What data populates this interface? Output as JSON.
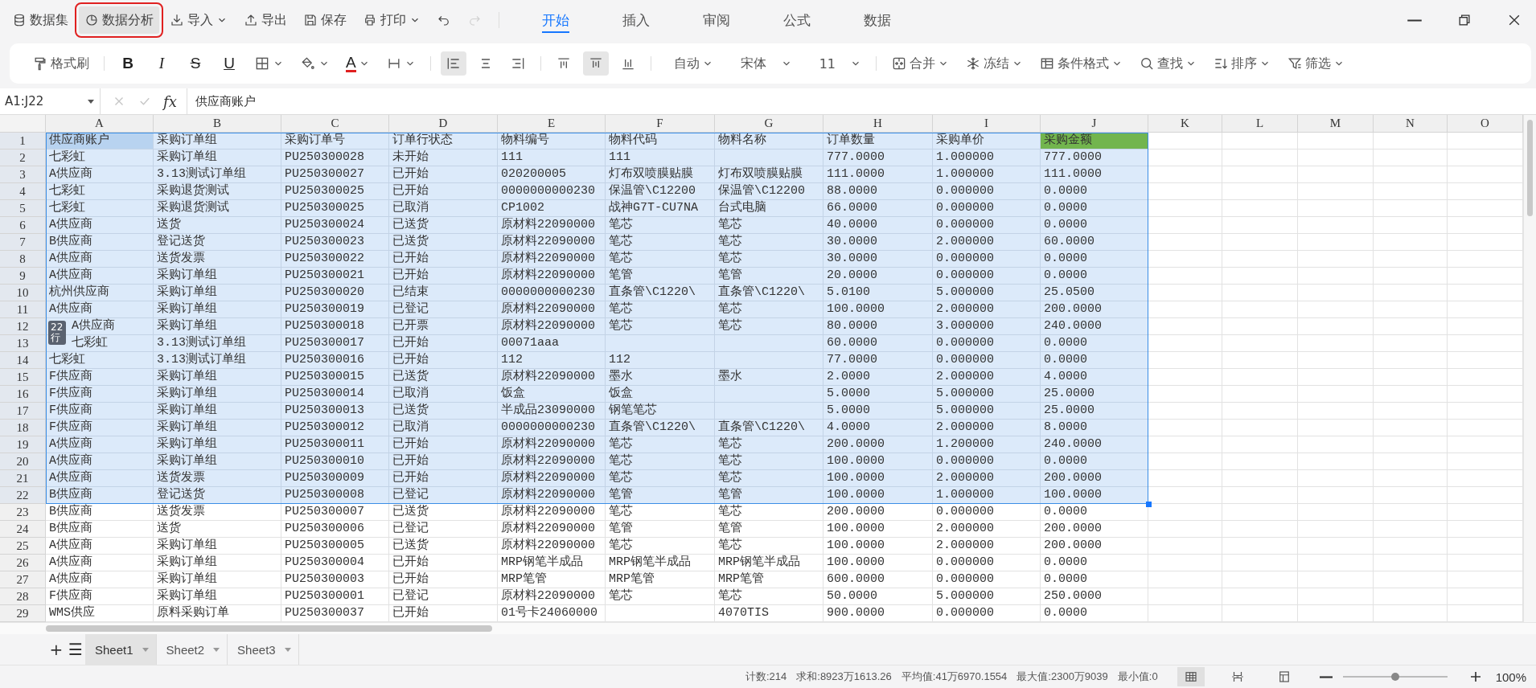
{
  "top_bar": {
    "items": [
      {
        "kind": "database",
        "label": "数据集",
        "caret": false,
        "highlighted": false,
        "disabled": false
      },
      {
        "kind": "pie",
        "label": "数据分析",
        "caret": false,
        "highlighted": true,
        "disabled": false
      },
      {
        "kind": "download",
        "label": "导入",
        "caret": true,
        "highlighted": false,
        "disabled": false
      },
      {
        "kind": "upload",
        "label": "导出",
        "caret": false,
        "highlighted": false,
        "disabled": false
      },
      {
        "kind": "save",
        "label": "保存",
        "caret": false,
        "highlighted": false,
        "disabled": false
      },
      {
        "kind": "printer",
        "label": "打印",
        "caret": true,
        "highlighted": false,
        "disabled": false
      },
      {
        "kind": "undo",
        "caret": false,
        "highlighted": false,
        "disabled": false
      },
      {
        "kind": "redo",
        "caret": false,
        "highlighted": false,
        "disabled": true
      }
    ],
    "tabs": [
      {
        "label": "开始",
        "selected": true
      },
      {
        "label": "插入",
        "selected": false
      },
      {
        "label": "审阅",
        "selected": false
      },
      {
        "label": "公式",
        "selected": false
      },
      {
        "label": "数据",
        "selected": false
      }
    ],
    "window_controls": [
      {
        "kind": "minimize"
      },
      {
        "kind": "restore"
      },
      {
        "kind": "close"
      }
    ]
  },
  "format_toolbar": {
    "groups": [
      [
        {
          "kind": "brush",
          "label": "格式刷",
          "caret": false,
          "selected": false
        }
      ],
      [
        {
          "kind": "bold",
          "glyph": "B",
          "caret": false,
          "selected": false
        },
        {
          "kind": "italic",
          "glyph": "I",
          "caret": false,
          "selected": false
        },
        {
          "kind": "strike",
          "glyph": "S",
          "caret": false,
          "selected": false
        },
        {
          "kind": "underline",
          "glyph": "U",
          "caret": false,
          "selected": false
        },
        {
          "kind": "border",
          "caret": true,
          "selected": false
        },
        {
          "kind": "bucket",
          "caret": true,
          "selected": false
        },
        {
          "kind": "font-color",
          "glyph": "A",
          "caret": true,
          "selected": false
        },
        {
          "kind": "colwidth",
          "caret": true,
          "selected": false
        }
      ],
      [
        {
          "kind": "align-left",
          "caret": false,
          "selected": true
        },
        {
          "kind": "align-center",
          "caret": false,
          "selected": false
        },
        {
          "kind": "align-right",
          "caret": false,
          "selected": false
        }
      ],
      [
        {
          "kind": "valign-top",
          "caret": false,
          "selected": false
        },
        {
          "kind": "valign-middle",
          "caret": false,
          "selected": true
        },
        {
          "kind": "valign-bottom",
          "caret": false,
          "selected": false
        }
      ],
      [
        {
          "kind": "select",
          "label": "自动",
          "caret": true,
          "selected": false
        },
        {
          "kind": "select-wide",
          "label": "宋体",
          "caret": true,
          "selected": false
        },
        {
          "kind": "select-wide",
          "label": "11",
          "caret": true,
          "selected": false
        }
      ],
      [
        {
          "kind": "merge",
          "label": "合并",
          "caret": true,
          "selected": false
        },
        {
          "kind": "snowflake",
          "label": "冻结",
          "caret": true,
          "selected": false
        },
        {
          "kind": "table",
          "label": "条件格式",
          "caret": true,
          "selected": false
        },
        {
          "kind": "search",
          "label": "查找",
          "caret": true,
          "selected": false
        },
        {
          "kind": "sort",
          "label": "排序",
          "caret": true,
          "selected": false
        },
        {
          "kind": "filter",
          "label": "筛选",
          "caret": true,
          "selected": false
        }
      ]
    ]
  },
  "formula_bar": {
    "name_box": "A1:J22",
    "fx": "fx",
    "content": "供应商账户"
  },
  "grid": {
    "columns": [
      "A",
      "B",
      "C",
      "D",
      "E",
      "F",
      "G",
      "H",
      "I",
      "J",
      "K",
      "L",
      "M",
      "N",
      "O"
    ],
    "row_count_badge": "22行",
    "rows": [
      {
        "num": "1",
        "selected": true,
        "active": true,
        "cells": [
          "供应商账户",
          "采购订单组",
          "采购订单号",
          "订单行状态",
          "物料编号",
          "物料代码",
          "物料名称",
          "订单数量",
          "采购单价",
          {
            "text": "采购金额",
            "color": "#72b54e"
          }
        ]
      },
      {
        "num": "2",
        "selected": true,
        "active": false,
        "cells": [
          "七彩虹",
          "采购订单组",
          "PU250300028",
          "未开始",
          "111",
          "111",
          null,
          "777.0000",
          "1.000000",
          "777.0000"
        ]
      },
      {
        "num": "3",
        "selected": true,
        "active": false,
        "cells": [
          "A供应商",
          "3.13测试订单组",
          "PU250300027",
          "已开始",
          "020200005",
          "灯布双喷膜贴膜",
          "灯布双喷膜贴膜",
          "111.0000",
          "1.000000",
          "111.0000"
        ]
      },
      {
        "num": "4",
        "selected": true,
        "active": false,
        "cells": [
          "七彩虹",
          "采购退货测试",
          "PU250300025",
          "已开始",
          "0000000000230",
          "保温管\\C12200",
          "保温管\\C12200",
          "88.0000",
          "0.000000",
          "0.0000"
        ]
      },
      {
        "num": "5",
        "selected": true,
        "active": false,
        "cells": [
          "七彩虹",
          "采购退货测试",
          "PU250300025",
          "已取消",
          "CP1002",
          "战神G7T-CU7NA",
          "台式电脑",
          "66.0000",
          "0.000000",
          "0.0000"
        ]
      },
      {
        "num": "6",
        "selected": true,
        "active": false,
        "cells": [
          "A供应商",
          "送货",
          "PU250300024",
          "已送货",
          "原材料22090000",
          "笔芯",
          "笔芯",
          "40.0000",
          "0.000000",
          "0.0000"
        ]
      },
      {
        "num": "7",
        "selected": true,
        "active": false,
        "cells": [
          "B供应商",
          "登记送货",
          "PU250300023",
          "已送货",
          "原材料22090000",
          "笔芯",
          "笔芯",
          "30.0000",
          "2.000000",
          "60.0000"
        ]
      },
      {
        "num": "8",
        "selected": true,
        "active": false,
        "cells": [
          "A供应商",
          "送货发票",
          "PU250300022",
          "已开始",
          "原材料22090000",
          "笔芯",
          "笔芯",
          "30.0000",
          "0.000000",
          "0.0000"
        ]
      },
      {
        "num": "9",
        "selected": true,
        "active": false,
        "cells": [
          "A供应商",
          "采购订单组",
          "PU250300021",
          "已开始",
          "原材料22090000",
          "笔管",
          "笔管",
          "20.0000",
          "0.000000",
          "0.0000"
        ]
      },
      {
        "num": "10",
        "selected": true,
        "active": false,
        "cells": [
          "杭州供应商",
          "采购订单组",
          "PU250300020",
          "已结束",
          "0000000000230",
          "直条管\\C1220\\",
          "直条管\\C1220\\",
          "5.0100",
          "5.000000",
          "25.0500"
        ]
      },
      {
        "num": "11",
        "selected": true,
        "active": false,
        "cells": [
          "A供应商",
          "采购订单组",
          "PU250300019",
          "已登记",
          "原材料22090000",
          "笔芯",
          "笔芯",
          "100.0000",
          "2.000000",
          "200.0000"
        ]
      },
      {
        "num": "12",
        "selected": true,
        "active": false,
        "cells": [
          "A供应商",
          "采购订单组",
          "PU250300018",
          "已开票",
          "原材料22090000",
          "笔芯",
          "笔芯",
          "80.0000",
          "3.000000",
          "240.0000"
        ]
      },
      {
        "num": "13",
        "selected": true,
        "active": false,
        "cells": [
          "七彩虹",
          "3.13测试订单组",
          "PU250300017",
          "已开始",
          "00071aaa",
          null,
          null,
          "60.0000",
          "0.000000",
          "0.0000"
        ]
      },
      {
        "num": "14",
        "selected": true,
        "active": false,
        "cells": [
          "七彩虹",
          "3.13测试订单组",
          "PU250300016",
          "已开始",
          "112",
          "112",
          null,
          "77.0000",
          "0.000000",
          "0.0000"
        ]
      },
      {
        "num": "15",
        "selected": true,
        "active": false,
        "cells": [
          "F供应商",
          "采购订单组",
          "PU250300015",
          "已送货",
          "原材料22090000",
          "墨水",
          "墨水",
          "2.0000",
          "2.000000",
          "4.0000"
        ]
      },
      {
        "num": "16",
        "selected": true,
        "active": false,
        "cells": [
          "F供应商",
          "采购订单组",
          "PU250300014",
          "已取消",
          "饭盒",
          "饭盒",
          null,
          "5.0000",
          "5.000000",
          "25.0000"
        ]
      },
      {
        "num": "17",
        "selected": true,
        "active": false,
        "cells": [
          "F供应商",
          "采购订单组",
          "PU250300013",
          "已送货",
          "半成品23090000",
          "钢笔笔芯",
          null,
          "5.0000",
          "5.000000",
          "25.0000"
        ]
      },
      {
        "num": "18",
        "selected": true,
        "active": false,
        "cells": [
          "F供应商",
          "采购订单组",
          "PU250300012",
          "已取消",
          "0000000000230",
          "直条管\\C1220\\",
          "直条管\\C1220\\",
          "4.0000",
          "2.000000",
          "8.0000"
        ]
      },
      {
        "num": "19",
        "selected": true,
        "active": false,
        "cells": [
          "A供应商",
          "采购订单组",
          "PU250300011",
          "已开始",
          "原材料22090000",
          "笔芯",
          "笔芯",
          "200.0000",
          "1.200000",
          "240.0000"
        ]
      },
      {
        "num": "20",
        "selected": true,
        "active": false,
        "cells": [
          "A供应商",
          "采购订单组",
          "PU250300010",
          "已开始",
          "原材料22090000",
          "笔芯",
          "笔芯",
          "100.0000",
          "0.000000",
          "0.0000"
        ]
      },
      {
        "num": "21",
        "selected": true,
        "active": false,
        "cells": [
          "A供应商",
          "送货发票",
          "PU250300009",
          "已开始",
          "原材料22090000",
          "笔芯",
          "笔芯",
          "100.0000",
          "2.000000",
          "200.0000"
        ]
      },
      {
        "num": "22",
        "selected": true,
        "active": false,
        "cells": [
          "B供应商",
          "登记送货",
          "PU250300008",
          "已登记",
          "原材料22090000",
          "笔管",
          "笔管",
          "100.0000",
          "1.000000",
          "100.0000"
        ]
      },
      {
        "num": "23",
        "selected": false,
        "active": false,
        "cells": [
          "B供应商",
          "送货发票",
          "PU250300007",
          "已送货",
          "原材料22090000",
          "笔芯",
          "笔芯",
          "200.0000",
          "0.000000",
          "0.0000"
        ]
      },
      {
        "num": "24",
        "selected": false,
        "active": false,
        "cells": [
          "B供应商",
          "送货",
          "PU250300006",
          "已登记",
          "原材料22090000",
          "笔管",
          "笔管",
          "100.0000",
          "2.000000",
          "200.0000"
        ]
      },
      {
        "num": "25",
        "selected": false,
        "active": false,
        "cells": [
          "A供应商",
          "采购订单组",
          "PU250300005",
          "已送货",
          "原材料22090000",
          "笔芯",
          "笔芯",
          "100.0000",
          "2.000000",
          "200.0000"
        ]
      },
      {
        "num": "26",
        "selected": false,
        "active": false,
        "cells": [
          "A供应商",
          "采购订单组",
          "PU250300004",
          "已开始",
          "MRP钢笔半成品",
          "MRP钢笔半成品",
          "MRP钢笔半成品",
          "100.0000",
          "0.000000",
          "0.0000"
        ]
      },
      {
        "num": "27",
        "selected": false,
        "active": false,
        "cells": [
          "A供应商",
          "采购订单组",
          "PU250300003",
          "已开始",
          "MRP笔管",
          "MRP笔管",
          "MRP笔管",
          "600.0000",
          "0.000000",
          "0.0000"
        ]
      },
      {
        "num": "28",
        "selected": false,
        "active": false,
        "cells": [
          "F供应商",
          "采购订单组",
          "PU250300001",
          "已登记",
          "原材料22090000",
          "笔芯",
          "笔芯",
          "50.0000",
          "5.000000",
          "250.0000"
        ]
      },
      {
        "num": "29",
        "selected": false,
        "active": false,
        "cells": [
          "WMS供应",
          "原料采购订单",
          "PU250300037",
          "已开始",
          "01号卡24060000",
          null,
          "4070TIS",
          "900.0000",
          "0.000000",
          "0.0000"
        ]
      }
    ]
  },
  "sheet_bar": {
    "add_glyph": "+",
    "menu_glyph": "☰",
    "sheets": [
      {
        "label": "Sheet1",
        "selected": true
      },
      {
        "label": "Sheet2",
        "selected": false
      },
      {
        "label": "Sheet3",
        "selected": false
      }
    ]
  },
  "status_bar": {
    "stats": [
      "计数:214",
      "求和:8923万1613.26",
      "平均值:41万6970.1554",
      "最大值:2300万9039",
      "最小值:0"
    ],
    "views": [
      {
        "kind": "normal",
        "selected": true
      },
      {
        "kind": "page-break",
        "selected": false
      },
      {
        "kind": "page-layout",
        "selected": false
      }
    ],
    "zoom": {
      "level": 0.5,
      "reading": "100%"
    }
  }
}
